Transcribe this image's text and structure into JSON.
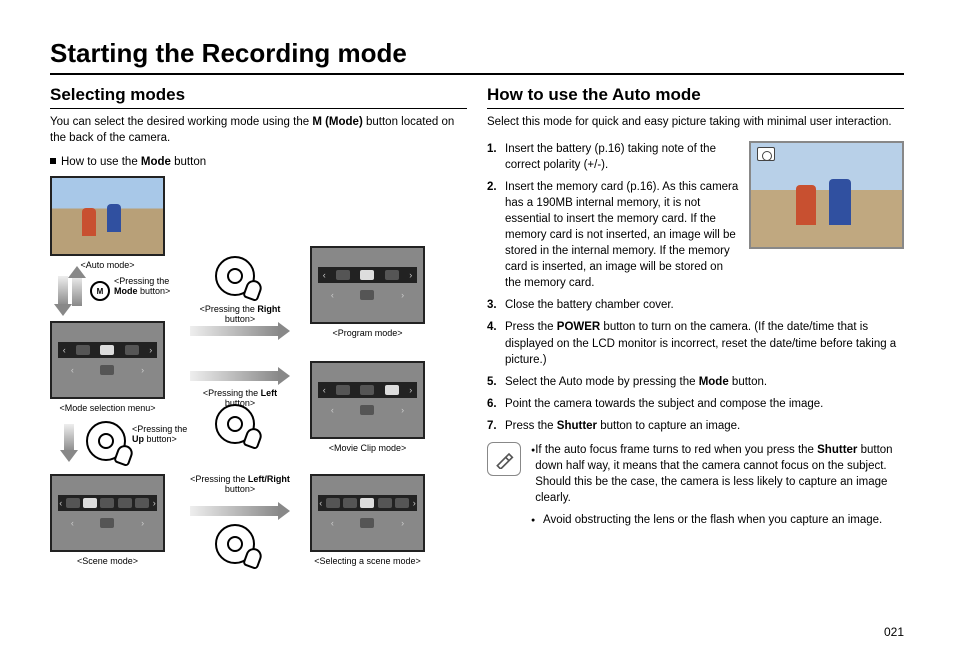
{
  "page_title": "Starting the Recording mode",
  "page_number": "021",
  "left": {
    "section_title": "Selecting modes",
    "intro_pre": "You can select the desired working mode using the ",
    "intro_bold": "M (Mode)",
    "intro_post": " button located on the back of the camera.",
    "howto_pre": "How to use the ",
    "howto_bold": "Mode",
    "howto_post": " button",
    "captions": {
      "auto": "<Auto mode>",
      "mode_sel": "<Mode selection menu>",
      "scene": "<Scene mode>",
      "press_mode_pre": "<Pressing the ",
      "press_mode_bold": "Mode",
      "press_mode_post": " button>",
      "press_up_pre": "<Pressing the ",
      "press_up_bold": "Up",
      "press_up_post": " button>",
      "press_right_pre": "<Pressing the ",
      "press_right_bold": "Right",
      "press_right_post": " button>",
      "press_left_pre": "<Pressing the ",
      "press_left_bold": "Left",
      "press_left_post": " button>",
      "press_lr_pre": "<Pressing the ",
      "press_lr_bold": "Left/Right",
      "press_lr_post": " button>",
      "program": "<Program mode>",
      "movie": "<Movie Clip mode>",
      "sel_scene": "<Selecting a scene mode>"
    }
  },
  "right": {
    "section_title": "How to use the Auto mode",
    "intro": "Select this mode for quick and easy picture taking with minimal user interaction.",
    "steps": [
      {
        "n": "1.",
        "t": "Insert the battery (p.16) taking note of the correct polarity (+/-)."
      },
      {
        "n": "2.",
        "t": "Insert the memory card (p.16). As this camera has a 190MB internal memory, it is not essential to insert the memory card. If the memory card is not inserted, an image will be stored in the internal memory. If the memory card is inserted, an image will be stored on the memory card."
      },
      {
        "n": "3.",
        "t": "Close the battery chamber cover."
      },
      {
        "n": "4.",
        "pre": "Press the ",
        "b1": "POWER",
        "post": " button to turn on the camera. (If the date/time that is displayed on the LCD monitor is incorrect, reset the date/time before taking a picture.)"
      },
      {
        "n": "5.",
        "pre": "Select the Auto mode by pressing the ",
        "b1": "Mode",
        "post": " button."
      },
      {
        "n": "6.",
        "t": "Point the camera towards the subject and compose the image."
      },
      {
        "n": "7.",
        "pre": "Press the ",
        "b1": "Shutter",
        "post": " button to capture an image."
      }
    ],
    "notes": [
      {
        "pre": "If the auto focus frame turns to red when you press the ",
        "b1": "Shutter",
        "post": " button down half way, it means that the camera cannot focus on the subject. Should this be the case, the camera is less likely to capture an image clearly."
      },
      {
        "t": "Avoid obstructing the lens or the flash when you capture an image."
      }
    ]
  }
}
